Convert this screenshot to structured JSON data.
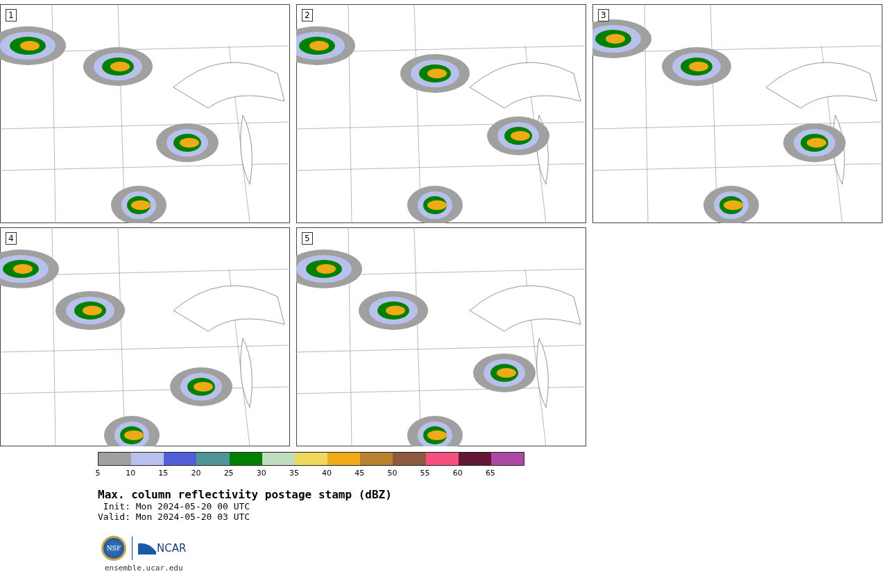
{
  "panels": [
    {
      "label": "1"
    },
    {
      "label": "2"
    },
    {
      "label": "3"
    },
    {
      "label": "4"
    },
    {
      "label": "5"
    }
  ],
  "colorbar": {
    "segments": [
      {
        "color": "#a0a0a0"
      },
      {
        "color": "#b7c1ec"
      },
      {
        "color": "#525fd6"
      },
      {
        "color": "#4f9598"
      },
      {
        "color": "#008000"
      },
      {
        "color": "#bfddbf"
      },
      {
        "color": "#efd95c"
      },
      {
        "color": "#efaa18"
      },
      {
        "color": "#b9812f"
      },
      {
        "color": "#8b5a3f"
      },
      {
        "color": "#f5507f"
      },
      {
        "color": "#641636"
      },
      {
        "color": "#ac4aa6"
      }
    ],
    "ticks": [
      "5",
      "10",
      "15",
      "20",
      "25",
      "30",
      "35",
      "40",
      "45",
      "50",
      "55",
      "60",
      "65"
    ]
  },
  "title": "Max. column reflectivity postage stamp (dBZ)",
  "init": " Init: Mon 2024-05-20 00 UTC",
  "valid": "Valid: Mon 2024-05-20 03 UTC",
  "logos": {
    "nsf": "NSF",
    "ncar": "NCAR"
  },
  "url": "ensemble.ucar.edu"
}
